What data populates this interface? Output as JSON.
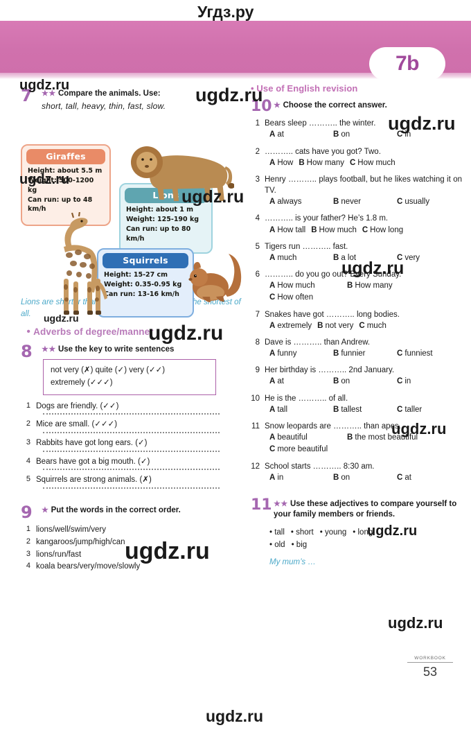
{
  "watermarks": {
    "top": "Угдз.ру",
    "bottom": "ugdz.ru",
    "small": "ugdz.ru",
    "large": "ugdz.ru"
  },
  "header": {
    "badge": "7b",
    "banner_color": "#d071ad",
    "badge_text_color": "#a0499b"
  },
  "left_column": {
    "ex7": {
      "number": "7",
      "stars": "★★",
      "instruction": "Compare the animals. Use:",
      "word_bank": "short, tall, heavy, thin, fast, slow.",
      "cards": [
        {
          "title": "Giraffes",
          "height": "Height: about 5.5 m",
          "weight": "Weight: 500-1200 kg",
          "speed": "Can run: up to 48 km/h",
          "header_color": "#e98b67",
          "body_color": "#fdeee6"
        },
        {
          "title": "Lions",
          "height": "Height: about 1 m",
          "weight": "Weight: 125-190 kg",
          "speed": "Can run: up to 80 km/h",
          "header_color": "#5fa5b0",
          "body_color": "#e5f3f6"
        },
        {
          "title": "Squirrels",
          "height": "Height: 15-27 cm",
          "weight": "Weight: 0.35-0.95 kg",
          "speed": "Can run: 13-16 km/h",
          "header_color": "#2f6fb5",
          "body_color": "#e3eefb"
        }
      ],
      "example": "Lions are shorter than giraffes, but squirrels are the shortest of all."
    },
    "section_heading": "Adverbs of degree/manner",
    "ex8": {
      "number": "8",
      "stars": "★★",
      "instruction": "Use the key to write sentences",
      "key_line1": "not very (✗)   quite (✓)   very (✓✓)",
      "key_line2": "extremely (✓✓✓)",
      "items": [
        {
          "n": "1",
          "text": "Dogs are friendly. (✓✓)"
        },
        {
          "n": "2",
          "text": "Mice are small. (✓✓✓)"
        },
        {
          "n": "3",
          "text": "Rabbits have got long ears. (✓)"
        },
        {
          "n": "4",
          "text": "Bears have got a big mouth. (✓)"
        },
        {
          "n": "5",
          "text": "Squirrels are strong animals. (✗)"
        }
      ]
    },
    "ex9": {
      "number": "9",
      "stars": "★",
      "instruction": "Put the words in the correct order.",
      "items": [
        {
          "n": "1",
          "text": "lions/well/swim/very"
        },
        {
          "n": "2",
          "text": "kangaroos/jump/high/can"
        },
        {
          "n": "3",
          "text": "lions/run/fast"
        },
        {
          "n": "4",
          "text": "koala bears/very/move/slowly"
        }
      ]
    }
  },
  "right_column": {
    "section_heading": "Use of English revision",
    "ex10": {
      "number": "10",
      "stars": "★",
      "instruction": "Choose the correct answer.",
      "questions": [
        {
          "n": "1",
          "text": "Bears sleep ……….. the winter.",
          "options": [
            "at",
            "on",
            "in"
          ],
          "layout": "cols3"
        },
        {
          "n": "2",
          "text": "……….. cats have you got? Two.",
          "options": [
            "How",
            "How many",
            "How much"
          ],
          "layout": "wide"
        },
        {
          "n": "3",
          "text": "Henry  ……….. plays football, but he likes watching it on TV.",
          "options": [
            "always",
            "never",
            "usually"
          ],
          "layout": "cols3"
        },
        {
          "n": "4",
          "text": "……….. is your father? He’s 1.8 m.",
          "options": [
            "How tall",
            "How much",
            "How long"
          ],
          "layout": "wide"
        },
        {
          "n": "5",
          "text": "Tigers run ……….. fast.",
          "options": [
            "much",
            "a lot",
            "very"
          ],
          "layout": "cols3"
        },
        {
          "n": "6",
          "text": "……….. do you go out? Every Sunday.",
          "options": [
            "How much",
            "How many",
            "How often"
          ],
          "layout": "spread"
        },
        {
          "n": "7",
          "text": "Snakes have got ……….. long bodies.",
          "options": [
            "extremely",
            "not very",
            "much"
          ],
          "layout": "wide"
        },
        {
          "n": "8",
          "text": "Dave is ……….. than Andrew.",
          "options": [
            "funny",
            "funnier",
            "funniest"
          ],
          "layout": "cols3"
        },
        {
          "n": "9",
          "text": "Her birthday is ……….. 2nd January.",
          "options": [
            "at",
            "on",
            "in"
          ],
          "layout": "cols3"
        },
        {
          "n": "10",
          "text": "He is the ……….. of all.",
          "options": [
            "tall",
            "tallest",
            "taller"
          ],
          "layout": "cols3"
        },
        {
          "n": "11",
          "text": "Snow leopards are ……….. than apes.",
          "options": [
            "beautiful",
            "the most beautiful",
            "more beautiful"
          ],
          "layout": "spread"
        },
        {
          "n": "12",
          "text": "School starts ……….. 8:30 am.",
          "options": [
            "in",
            "on",
            "at"
          ],
          "layout": "cols3"
        }
      ],
      "option_letters": [
        "A",
        "B",
        "C"
      ]
    },
    "ex11": {
      "number": "11",
      "stars": "★★",
      "instruction": "Use these adjectives to compare yourself to your family members or friends.",
      "adjectives_row1": [
        "tall",
        "short",
        "young",
        "long"
      ],
      "adjectives_row2": [
        "old",
        "big"
      ],
      "prompt": "My mum’s …"
    }
  },
  "footer": {
    "label": "WORKBOOK",
    "page": "53"
  }
}
